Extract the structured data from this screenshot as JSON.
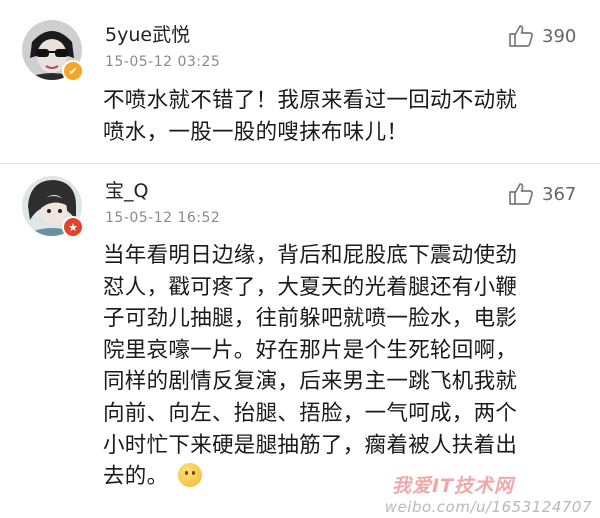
{
  "comments": [
    {
      "username": "5yue武悦",
      "timestamp": "15-05-12 03:25",
      "likes": "390",
      "badge": "v-badge",
      "lines": [
        "不喷水就不错了！我原来看过一回动不动就",
        "喷水，一股一股的嗖抹布味儿！"
      ]
    },
    {
      "username": "宝_Q",
      "timestamp": "15-05-12 16:52",
      "likes": "367",
      "badge": "star-badge",
      "lines": [
        "当年看明日边缘，背后和屁股底下震动使劲",
        "怼人，戳可疼了，大夏天的光着腿还有小鞭",
        "子可劲儿抽腿，往前躲吧就喷一脸水，电影",
        "院里哀嚎一片。好在那片是个生死轮回啊，",
        "同样的剧情反复演，后来男主一跳飞机我就",
        "向前、向左、抬腿、捂脸，一气呵成，两个",
        "小时忙下来硬是腿抽筋了，瘸着被人扶着出",
        "去的。"
      ]
    }
  ],
  "watermark": {
    "logo": "我爱IT技术网",
    "text": "weibo.com/u/1653124707"
  },
  "colors": {
    "v_badge": "#f5a623",
    "star_badge": "#e0452c"
  }
}
